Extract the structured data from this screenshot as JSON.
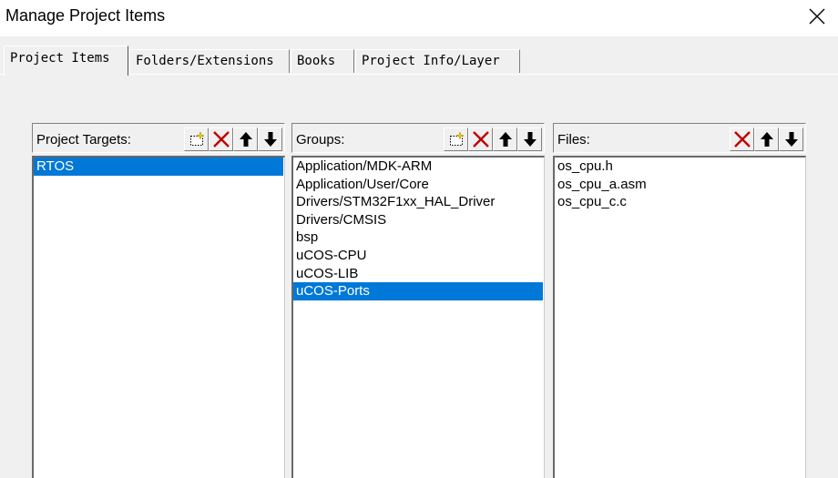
{
  "window": {
    "title": "Manage Project Items"
  },
  "tabs": [
    {
      "label": "Project Items",
      "active": true
    },
    {
      "label": "Folders/Extensions",
      "active": false
    },
    {
      "label": "Books",
      "active": false
    },
    {
      "label": "Project Info/Layer",
      "active": false
    }
  ],
  "targets": {
    "label": "Project Targets:",
    "items": [
      "RTOS"
    ],
    "selected": 0
  },
  "groups": {
    "label": "Groups:",
    "items": [
      "Application/MDK-ARM",
      "Application/User/Core",
      "Drivers/STM32F1xx_HAL_Driver",
      "Drivers/CMSIS",
      "bsp",
      "uCOS-CPU",
      "uCOS-LIB",
      "uCOS-Ports"
    ],
    "selected": 7
  },
  "files": {
    "label": "Files:",
    "items": [
      "os_cpu.h",
      "os_cpu_a.asm",
      "os_cpu_c.c"
    ]
  },
  "icons": {
    "new": "new-item-icon",
    "delete": "delete-icon",
    "up": "move-up-icon",
    "down": "move-down-icon",
    "close": "close-icon"
  },
  "colors": {
    "selection": "#0078d7",
    "delete": "#c00000"
  }
}
